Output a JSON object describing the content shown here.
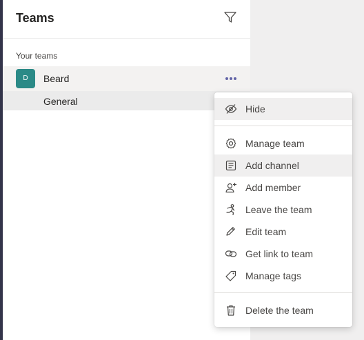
{
  "panel": {
    "title": "Teams",
    "section_label": "Your teams"
  },
  "team": {
    "avatar_initial": "D",
    "avatar_color": "#2b8a87",
    "name": "Beard",
    "channels": [
      "General"
    ]
  },
  "icons": {
    "filter": "filter-icon",
    "more": "more-options-icon"
  },
  "menu": {
    "items": [
      {
        "label": "Hide",
        "icon": "hide-icon"
      },
      {
        "label": "Manage team",
        "icon": "gear-icon"
      },
      {
        "label": "Add channel",
        "icon": "add-channel-icon"
      },
      {
        "label": "Add member",
        "icon": "add-member-icon"
      },
      {
        "label": "Leave the team",
        "icon": "leave-icon"
      },
      {
        "label": "Edit team",
        "icon": "pencil-icon"
      },
      {
        "label": "Get link to team",
        "icon": "link-icon"
      },
      {
        "label": "Manage tags",
        "icon": "tag-icon"
      },
      {
        "label": "Delete the team",
        "icon": "trash-icon"
      }
    ]
  },
  "colors": {
    "rail": "#33344a",
    "accent": "#6264a7",
    "hover": "#f0efef"
  }
}
